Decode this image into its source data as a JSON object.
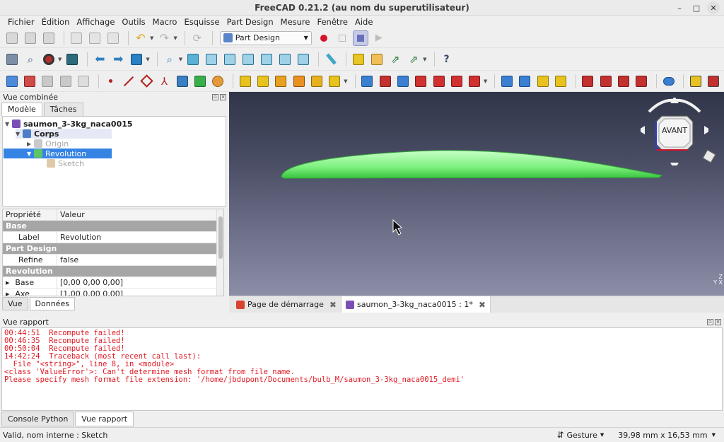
{
  "window": {
    "title": "FreeCAD 0.21.2 (au nom du superutilisateur)"
  },
  "menu": [
    "Fichier",
    "Édition",
    "Affichage",
    "Outils",
    "Macro",
    "Esquisse",
    "Part Design",
    "Mesure",
    "Fenêtre",
    "Aide"
  ],
  "toolbar": {
    "workbench": "Part Design"
  },
  "combo_view": {
    "title": "Vue combinée",
    "tabs": [
      "Modèle",
      "Tâches"
    ],
    "tree": {
      "document": "saumon_3-3kg_naca0015",
      "body": "Corps",
      "origin": "Origin",
      "revolution": "Revolution",
      "sketch": "Sketch"
    },
    "properties": {
      "header": [
        "Propriété",
        "Valeur"
      ],
      "groups": {
        "base": "Base",
        "part_design": "Part Design",
        "revolution": "Revolution"
      },
      "rows": {
        "label": [
          "Label",
          "Revolution"
        ],
        "refine": [
          "Refine",
          "false"
        ],
        "base": [
          "Base",
          "[0,00 0,00 0,00]"
        ],
        "axe": [
          "Axe",
          "[1,00 0,00 0,00]"
        ]
      }
    },
    "bottom_tabs": [
      "Vue",
      "Données"
    ]
  },
  "viewport": {
    "navcube_face": "AVANT",
    "axis_labels": "Z\nY X"
  },
  "doc_tabs": [
    "Page de démarrage",
    "saumon_3-3kg_naca0015 : 1*"
  ],
  "report": {
    "title": "Vue rapport",
    "lines": "00:44:51  Recompute failed!\n00:46:35  Recompute failed!\n00:50:04  Recompute failed!\n14:42:24  Traceback (most recent call last):\n  File \"<string>\", line 8, in <module>\n<class 'ValueError'>: Can't determine mesh format from file name.\nPlease specify mesh format file extension: '/home/jbdupont/Documents/bulb_M/saumon_3-3kg_naca0015_demi'",
    "tabs": [
      "Console Python",
      "Vue rapport"
    ]
  },
  "statusbar": {
    "text": "Valid, nom interne : Sketch",
    "nav_style": "Gesture",
    "dimensions": "39,98 mm x 16,53 mm"
  }
}
